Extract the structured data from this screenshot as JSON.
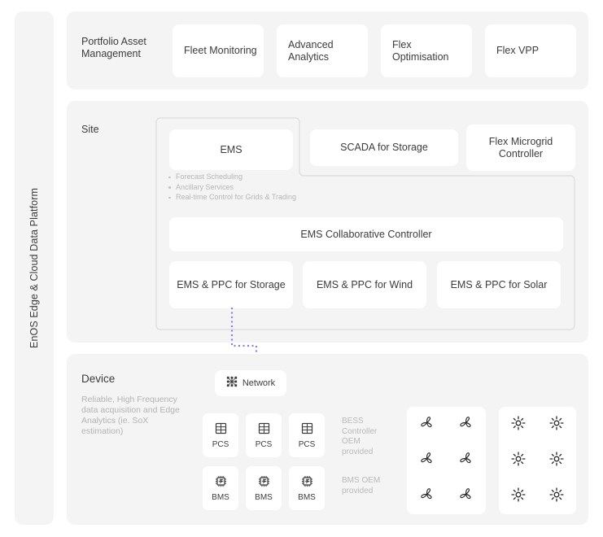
{
  "platform": {
    "label": "EnOS Edge & Cloud Data Platform"
  },
  "application_layer": {
    "row_label": "Portfolio Asset Management",
    "cards": [
      {
        "label": "Fleet Monitoring"
      },
      {
        "label": "Advanced Analytics"
      },
      {
        "label": "Flex Optimisation"
      },
      {
        "label": "Flex VPP"
      }
    ]
  },
  "site_layer": {
    "row_label": "Site",
    "ems_card": "EMS",
    "ems_bullets": [
      "Forecast Scheduling",
      "Ancillary Services",
      "Real-time Control for Grids & Trading"
    ],
    "scada_card": "SCADA for Storage",
    "microgrid_card": "Flex Microgrid Controller",
    "collaborative_controller": "EMS Collaborative Controller",
    "ppc_cards": [
      {
        "label": "EMS & PPC for Storage"
      },
      {
        "label": "EMS & PPC for Wind"
      },
      {
        "label": "EMS & PPC for Solar"
      }
    ]
  },
  "device_layer": {
    "row_label": "Device",
    "description": "Reliable, High Frequency data acquisition and Edge Analytics (ie. SoX estimation)",
    "network_card": {
      "label": "Network",
      "icon": "network-mesh-icon"
    },
    "pcs_tiles": [
      {
        "label": "PCS",
        "icon": "pcs-grid-icon"
      },
      {
        "label": "PCS",
        "icon": "pcs-grid-icon"
      },
      {
        "label": "PCS",
        "icon": "pcs-grid-icon"
      }
    ],
    "bms_tiles": [
      {
        "label": "BMS",
        "icon": "chip-icon"
      },
      {
        "label": "BMS",
        "icon": "chip-icon"
      },
      {
        "label": "BMS",
        "icon": "chip-icon"
      }
    ],
    "notes": [
      {
        "text": "BESS Controller OEM provided"
      },
      {
        "text": "BMS OEM provided"
      }
    ],
    "wind_panel": {
      "icon": "wind-turbine-icon",
      "count": 6
    },
    "solar_panel": {
      "icon": "sun-icon",
      "count": 6
    }
  },
  "colors": {
    "panel_bg": "#f4f4f4",
    "card_bg": "#ffffff",
    "text": "#3c3c3c",
    "muted_text": "#b6b6b6",
    "outline": "#dcdcdc",
    "connector": "#8a7de8"
  }
}
